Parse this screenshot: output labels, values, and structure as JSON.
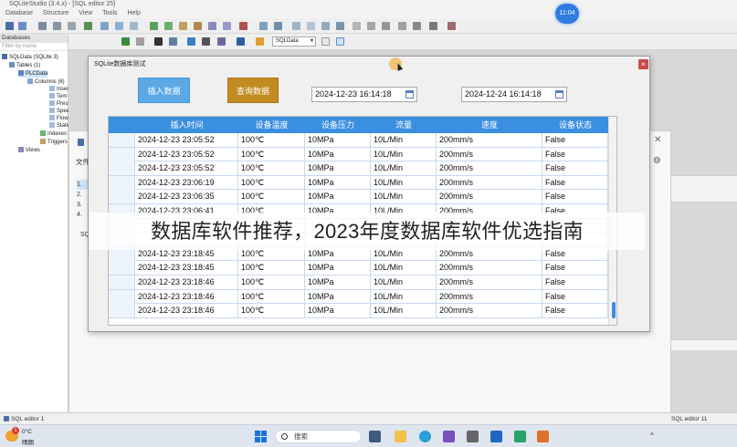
{
  "window": {
    "title": "SQLiteStudio (3.4.x) - [SQL editor 25]"
  },
  "menubar": [
    "Database",
    "Structure",
    "View",
    "Tools",
    "Help"
  ],
  "toolbar": {
    "db_select": "SQLData"
  },
  "db_panel": {
    "title": "Databases",
    "filter_placeholder": "Filter by name",
    "tree": [
      {
        "label": "SQLData (SQLite 3)",
        "level": 0
      },
      {
        "label": "Tables (1)",
        "level": 1
      },
      {
        "label": "PLCData",
        "level": 2
      },
      {
        "label": "Columns (6)",
        "level": 3
      },
      {
        "label": "InsertTime",
        "level": 4
      },
      {
        "label": "Tem",
        "level": 4
      },
      {
        "label": "Pressure",
        "level": 4
      },
      {
        "label": "Speed",
        "level": 4
      },
      {
        "label": "Flow",
        "level": 4
      },
      {
        "label": "State",
        "level": 4
      },
      {
        "label": "Indexes",
        "level": 3
      },
      {
        "label": "Triggers",
        "level": 3
      },
      {
        "label": "Views",
        "level": 1
      }
    ]
  },
  "background_dialog": {
    "label_wen": "文件",
    "list_items": [
      "1.",
      "2.",
      "3.",
      "4."
    ],
    "label_sq": "SQ"
  },
  "status_tabs": {
    "left": "SQL editor 1",
    "right": "SQL editor 11"
  },
  "dialog": {
    "title": "SQLite数据库测试",
    "insert_button": "插入数据",
    "query_button": "查询数据",
    "start_date": "2024-12-23 16:14:18",
    "end_date": "2024-12-24 16:14:18",
    "columns": [
      "插入时间",
      "设备温度",
      "设备压力",
      "流量",
      "速度",
      "设备状态"
    ],
    "rows": [
      [
        "2024-12-23 23:05:52",
        "100℃",
        "10MPa",
        "10L/Min",
        "200mm/s",
        "False"
      ],
      [
        "2024-12-23 23:05:52",
        "100℃",
        "10MPa",
        "10L/Min",
        "200mm/s",
        "False"
      ],
      [
        "2024-12-23 23:05:52",
        "100℃",
        "10MPa",
        "10L/Min",
        "200mm/s",
        "False"
      ],
      [
        "2024-12-23 23:06:19",
        "100℃",
        "10MPa",
        "10L/Min",
        "200mm/s",
        "False"
      ],
      [
        "2024-12-23 23:06:35",
        "100℃",
        "10MPa",
        "10L/Min",
        "200mm/s",
        "False"
      ],
      [
        "2024-12-23 23:06:41",
        "100℃",
        "10MPa",
        "10L/Min",
        "200mm/s",
        "False"
      ],
      [
        "",
        "",
        "",
        "",
        "",
        ""
      ],
      [
        "",
        "",
        "",
        "",
        "",
        ""
      ],
      [
        "2024-12-23 23:18:45",
        "100℃",
        "10MPa",
        "10L/Min",
        "200mm/s",
        "False"
      ],
      [
        "2024-12-23 23:18:45",
        "100℃",
        "10MPa",
        "10L/Min",
        "200mm/s",
        "False"
      ],
      [
        "2024-12-23 23:18:46",
        "100℃",
        "10MPa",
        "10L/Min",
        "200mm/s",
        "False"
      ],
      [
        "2024-12-23 23:18:46",
        "100℃",
        "10MPa",
        "10L/Min",
        "200mm/s",
        "False"
      ],
      [
        "2024-12-23 23:18:46",
        "100℃",
        "10MPa",
        "10L/Min",
        "200mm/s",
        "False"
      ]
    ]
  },
  "caption": "数据库软件推荐，2023年度数据库软件优选指南",
  "time_badge": "11:04",
  "taskbar": {
    "weather_temp": "0°C",
    "weather_desc": "晴朗",
    "weather_badge": "1",
    "search_placeholder": "搜索"
  },
  "colors": {
    "header_blue": "#3b8fe0",
    "insert_button": "#5aa8e6",
    "query_button": "#c28b22",
    "close_red": "#c94b4b"
  }
}
